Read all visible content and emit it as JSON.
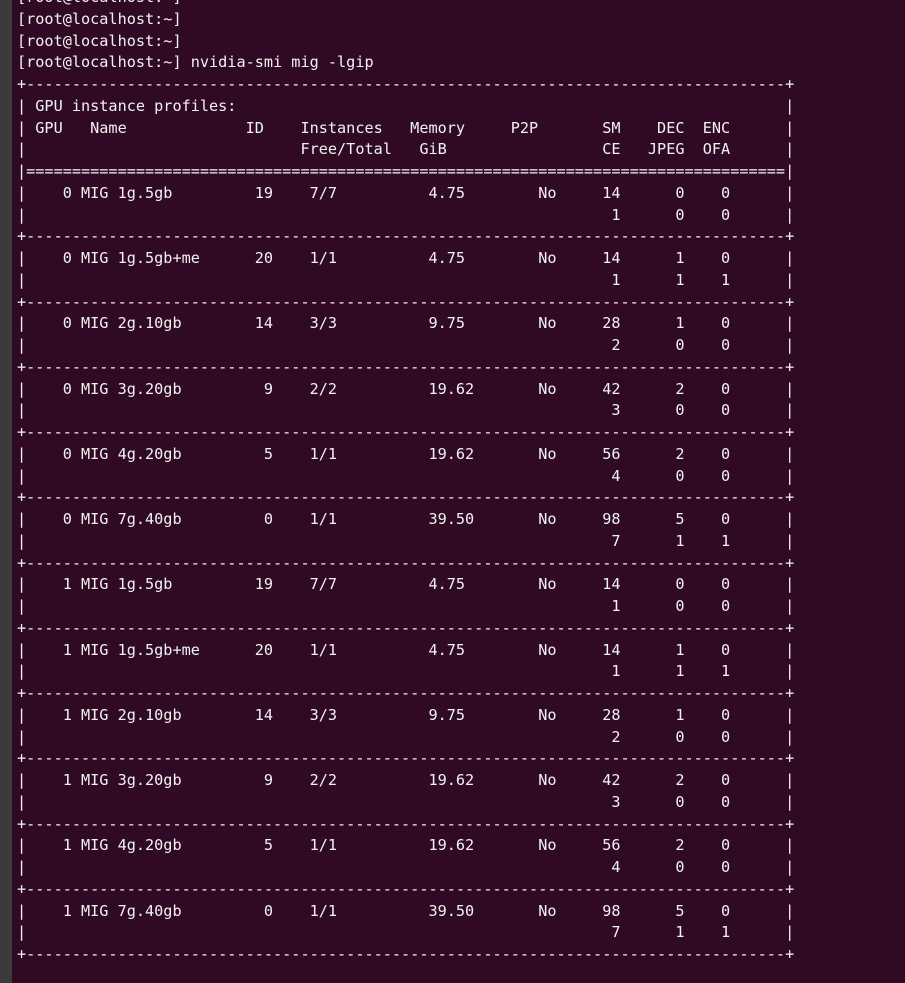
{
  "prompts": [
    {
      "text": "[root@localhost:~]"
    },
    {
      "text": "[root@localhost:~]"
    },
    {
      "text": "[root@localhost:~]"
    },
    {
      "text": "[root@localhost:~] nvidia-smi mig -lgip"
    }
  ],
  "table": {
    "title": "GPU instance profiles:",
    "headers": {
      "gpu": "GPU",
      "name": "Name",
      "id": "ID",
      "instances": "Instances",
      "instances_sub": "Free/Total",
      "memory": "Memory",
      "memory_sub": "GiB",
      "p2p": "P2P",
      "sm": "SM",
      "ce": "CE",
      "dec": "DEC",
      "jpeg": "JPEG",
      "enc": "ENC",
      "ofa": "OFA"
    },
    "rows": [
      {
        "gpu": "0",
        "name": "MIG 1g.5gb",
        "id": "19",
        "instances": "7/7",
        "memory": "4.75",
        "p2p": "No",
        "sm": "14",
        "dec": "0",
        "enc": "0",
        "ce": "1",
        "jpeg": "0",
        "ofa": "0"
      },
      {
        "gpu": "0",
        "name": "MIG 1g.5gb+me",
        "id": "20",
        "instances": "1/1",
        "memory": "4.75",
        "p2p": "No",
        "sm": "14",
        "dec": "1",
        "enc": "0",
        "ce": "1",
        "jpeg": "1",
        "ofa": "1"
      },
      {
        "gpu": "0",
        "name": "MIG 2g.10gb",
        "id": "14",
        "instances": "3/3",
        "memory": "9.75",
        "p2p": "No",
        "sm": "28",
        "dec": "1",
        "enc": "0",
        "ce": "2",
        "jpeg": "0",
        "ofa": "0"
      },
      {
        "gpu": "0",
        "name": "MIG 3g.20gb",
        "id": "9",
        "instances": "2/2",
        "memory": "19.62",
        "p2p": "No",
        "sm": "42",
        "dec": "2",
        "enc": "0",
        "ce": "3",
        "jpeg": "0",
        "ofa": "0"
      },
      {
        "gpu": "0",
        "name": "MIG 4g.20gb",
        "id": "5",
        "instances": "1/1",
        "memory": "19.62",
        "p2p": "No",
        "sm": "56",
        "dec": "2",
        "enc": "0",
        "ce": "4",
        "jpeg": "0",
        "ofa": "0"
      },
      {
        "gpu": "0",
        "name": "MIG 7g.40gb",
        "id": "0",
        "instances": "1/1",
        "memory": "39.50",
        "p2p": "No",
        "sm": "98",
        "dec": "5",
        "enc": "0",
        "ce": "7",
        "jpeg": "1",
        "ofa": "1"
      },
      {
        "gpu": "1",
        "name": "MIG 1g.5gb",
        "id": "19",
        "instances": "7/7",
        "memory": "4.75",
        "p2p": "No",
        "sm": "14",
        "dec": "0",
        "enc": "0",
        "ce": "1",
        "jpeg": "0",
        "ofa": "0"
      },
      {
        "gpu": "1",
        "name": "MIG 1g.5gb+me",
        "id": "20",
        "instances": "1/1",
        "memory": "4.75",
        "p2p": "No",
        "sm": "14",
        "dec": "1",
        "enc": "0",
        "ce": "1",
        "jpeg": "1",
        "ofa": "1"
      },
      {
        "gpu": "1",
        "name": "MIG 2g.10gb",
        "id": "14",
        "instances": "3/3",
        "memory": "9.75",
        "p2p": "No",
        "sm": "28",
        "dec": "1",
        "enc": "0",
        "ce": "2",
        "jpeg": "0",
        "ofa": "0"
      },
      {
        "gpu": "1",
        "name": "MIG 3g.20gb",
        "id": "9",
        "instances": "2/2",
        "memory": "19.62",
        "p2p": "No",
        "sm": "42",
        "dec": "2",
        "enc": "0",
        "ce": "3",
        "jpeg": "0",
        "ofa": "0"
      },
      {
        "gpu": "1",
        "name": "MIG 4g.20gb",
        "id": "5",
        "instances": "1/1",
        "memory": "19.62",
        "p2p": "No",
        "sm": "56",
        "dec": "2",
        "enc": "0",
        "ce": "4",
        "jpeg": "0",
        "ofa": "0"
      },
      {
        "gpu": "1",
        "name": "MIG 7g.40gb",
        "id": "0",
        "instances": "1/1",
        "memory": "39.50",
        "p2p": "No",
        "sm": "98",
        "dec": "5",
        "enc": "0",
        "ce": "7",
        "jpeg": "1",
        "ofa": "1"
      }
    ]
  },
  "colors": {
    "background": "#300a24",
    "foreground": "#f2f2f2",
    "left_edge": "#3b3b3b"
  }
}
